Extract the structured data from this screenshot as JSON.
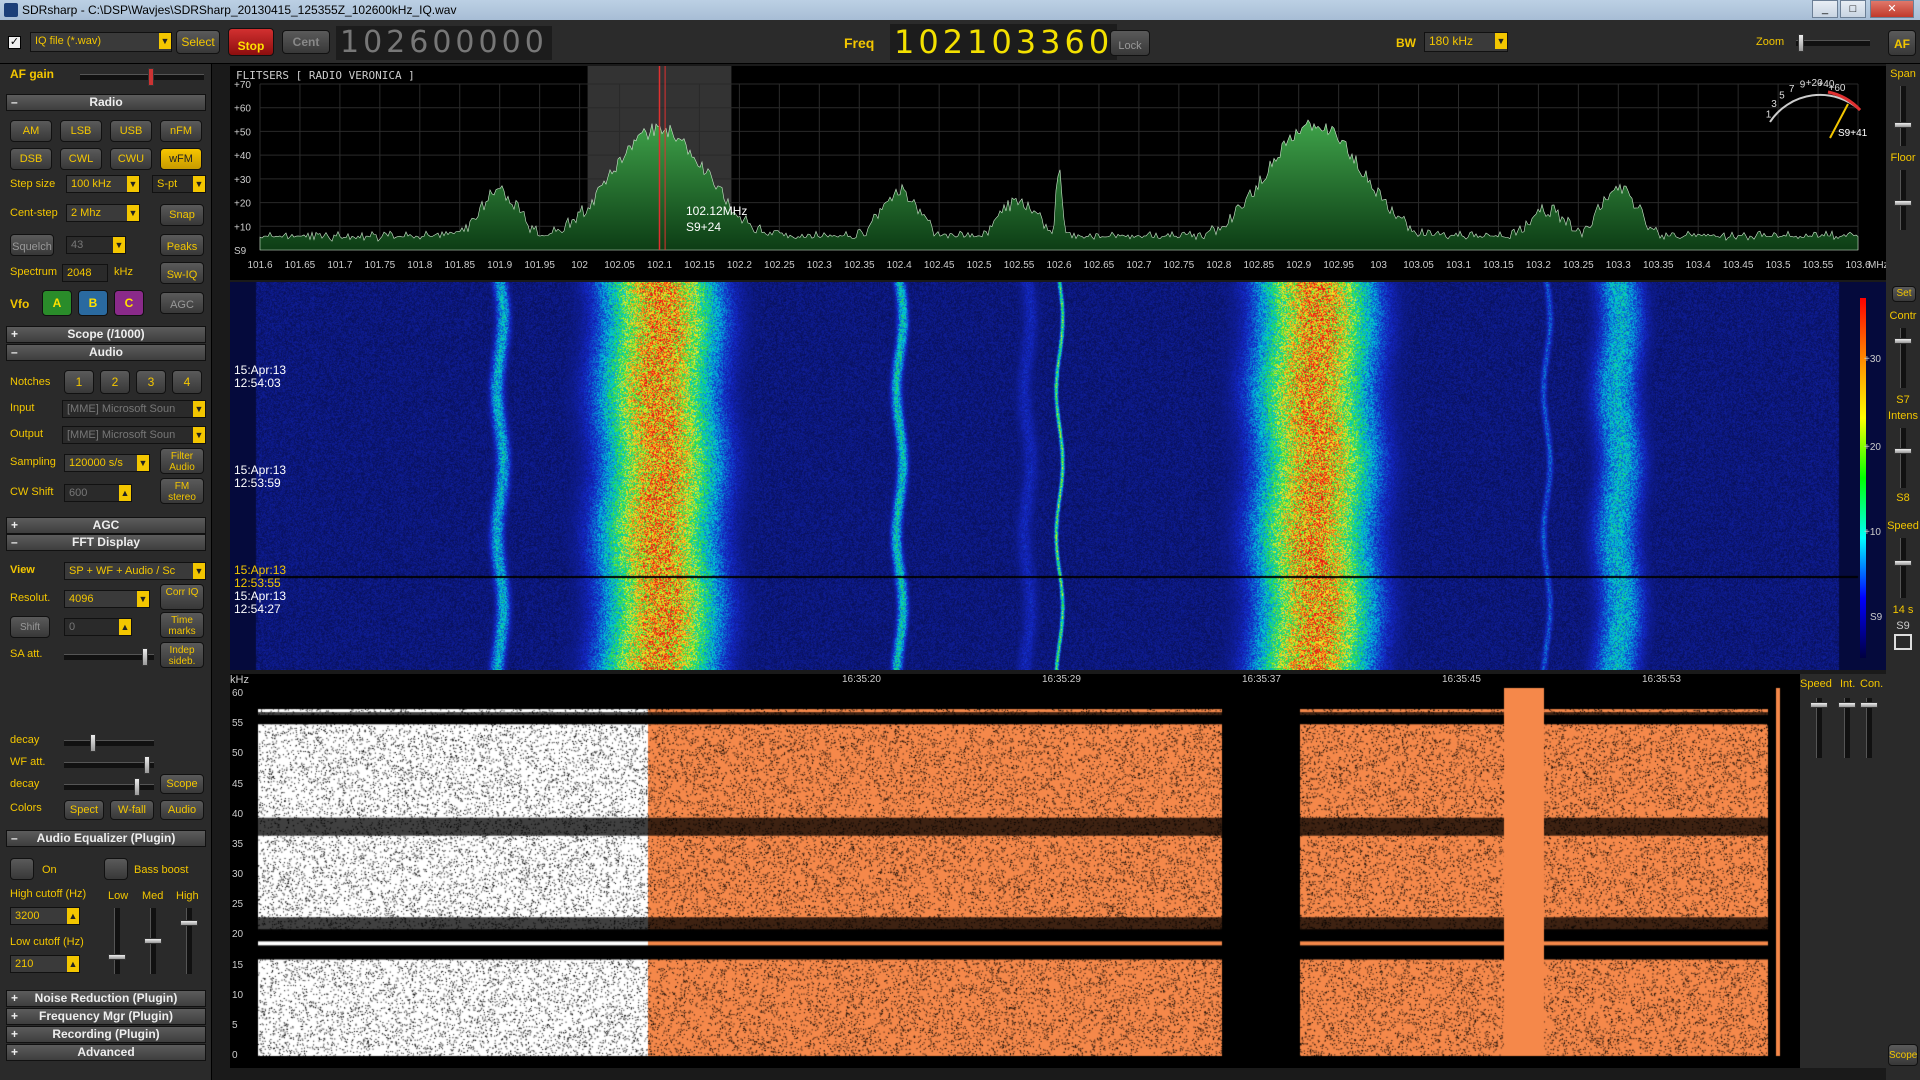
{
  "window": {
    "title": "SDRsharp - C:\\DSP\\Wavjes\\SDRSharp_20130415_125355Z_102600kHz_IQ.wav"
  },
  "toolbar": {
    "source_select": "IQ file (*.wav)",
    "select_label": "Select",
    "stop_label": "Stop",
    "cent_label": "Cent",
    "center_freq": "102600000",
    "freq_label": "Freq",
    "freq_value": "102103360",
    "lock_label": "Lock",
    "bw_label": "BW",
    "bw_value": "180 kHz",
    "zoom_label": "Zoom",
    "af_label": "AF"
  },
  "left": {
    "af_gain": "AF gain",
    "radio_header": "Radio",
    "modes": [
      "AM",
      "LSB",
      "USB",
      "nFM",
      "DSB",
      "CWL",
      "CWU",
      "wFM"
    ],
    "step_size_label": "Step size",
    "step_size": "100 kHz",
    "spt": "S-pt",
    "cent_step_label": "Cent-step",
    "cent_step": "2 Mhz",
    "snap": "Snap",
    "squelch": "Squelch",
    "squelch_value": "43",
    "peaks": "Peaks",
    "spectrum_label": "Spectrum",
    "spectrum_value": "2048",
    "spectrum_unit": "kHz",
    "swiq": "Sw-IQ",
    "vfo_label": "Vfo",
    "vfo": [
      "A",
      "B",
      "C"
    ],
    "agc_btn": "AGC",
    "scope_header": "Scope (/1000)",
    "audio_header": "Audio",
    "notches_label": "Notches",
    "notches": [
      "1",
      "2",
      "3",
      "4"
    ],
    "input_label": "Input",
    "input_value": "[MME] Microsoft Soun",
    "output_label": "Output",
    "output_value": "[MME] Microsoft Soun",
    "sampling_label": "Sampling",
    "sampling_value": "120000 s/s",
    "filter_audio": "Filter Audio",
    "cwshift_label": "CW Shift",
    "cwshift_value": "600",
    "fm_stereo": "FM stereo",
    "agc_header": "AGC",
    "fft_header": "FFT Display",
    "view_label": "View",
    "view_value": "SP + WF + Audio / Sc",
    "resol_label": "Resolut.",
    "resol_value": "4096",
    "corr_iq": "Corr IQ",
    "shift": "Shift",
    "shift_value": "0",
    "time_marks": "Time marks",
    "sa_att": "SA att.",
    "indep_sideb": "Indep sideb.",
    "decay1": "decay",
    "wf_att": "WF att.",
    "decay2": "decay",
    "scope_btn": "Scope",
    "colors_label": "Colors",
    "spect_btn": "Spect",
    "wfall_btn": "W-fall",
    "audio_btn": "Audio",
    "eq_header": "Audio Equalizer (Plugin)",
    "on_label": "On",
    "bass_boost": "Bass boost",
    "high_cutoff_label": "High cutoff (Hz)",
    "high_cutoff": "3200",
    "low_cutoff_label": "Low cutoff (Hz)",
    "low_cutoff": "210",
    "eq_low": "Low",
    "eq_med": "Med",
    "eq_high": "High",
    "noise_header": "Noise Reduction (Plugin)",
    "freqmgr_header": "Frequency Mgr (Plugin)",
    "recording_header": "Recording (Plugin)",
    "advanced_header": "Advanced"
  },
  "spectrum": {
    "station_name": "FLITSERS [ RADIO VERONICA ]",
    "y_ticks": [
      "+70",
      "+60",
      "+50",
      "+40",
      "+30",
      "+20",
      "+10",
      "S9"
    ],
    "x_ticks": [
      "101.6",
      "101.65",
      "101.7",
      "101.75",
      "101.8",
      "101.85",
      "101.9",
      "101.95",
      "102",
      "102.05",
      "102.1",
      "102.15",
      "102.2",
      "102.25",
      "102.3",
      "102.35",
      "102.4",
      "102.45",
      "102.5",
      "102.55",
      "102.6",
      "102.65",
      "102.7",
      "102.75",
      "102.8",
      "102.85",
      "102.9",
      "102.95",
      "103",
      "103.05",
      "103.1",
      "103.15",
      "103.2",
      "103.25",
      "103.3",
      "103.35",
      "103.4",
      "103.45",
      "103.5",
      "103.55",
      "103.6"
    ],
    "x_unit": "MHz",
    "cursor_freq": "102.12MHz",
    "cursor_level": "S9+24",
    "smeter_ticks": [
      "1",
      "3",
      "5",
      "7",
      "9",
      "+20",
      "+40",
      "+60"
    ],
    "smeter_reading": "S9+41",
    "peaks": [
      {
        "f": 101.9,
        "h": 22
      },
      {
        "f": 102.1,
        "h": 48
      },
      {
        "f": 102.4,
        "h": 22
      },
      {
        "f": 102.55,
        "h": 18
      },
      {
        "f": 102.6,
        "h": 30
      },
      {
        "f": 102.92,
        "h": 50
      },
      {
        "f": 103.21,
        "h": 14
      },
      {
        "f": 103.3,
        "h": 24
      }
    ]
  },
  "waterfall": {
    "timestamps": [
      "15:Apr:13\n12:54:03",
      "15:Apr:13\n12:53:59",
      "15:Apr:13\n12:53:55",
      "15:Apr:13\n12:54:27"
    ],
    "color_scale": [
      "+30",
      "+20",
      "+10",
      "S9"
    ]
  },
  "audio": {
    "y_unit": "kHz",
    "y_ticks": [
      "60",
      "55",
      "50",
      "45",
      "40",
      "35",
      "30",
      "25",
      "20",
      "15",
      "10",
      "5",
      "0"
    ],
    "time_ticks": [
      "16:35:20",
      "16:35:29",
      "16:35:37",
      "16:35:45",
      "16:35:53"
    ],
    "speed_label": "Speed",
    "int_label": "Int.",
    "con_label": "Con."
  },
  "right": {
    "span_label": "Span",
    "floor_label": "Floor",
    "set_label": "Set",
    "contr_label": "Contr",
    "s7_label": "S7",
    "intens_label": "Intens",
    "s8_label": "S8",
    "speed_label": "Speed",
    "speed_value": "14 s",
    "s9_label": "S9",
    "scope_label": "Scope"
  },
  "colors": {
    "accent": "#f3c600",
    "spectrum_fill": "#1f7d2f",
    "audio_orange": "#f5884a",
    "wf_bg": "#0a1a4a"
  }
}
